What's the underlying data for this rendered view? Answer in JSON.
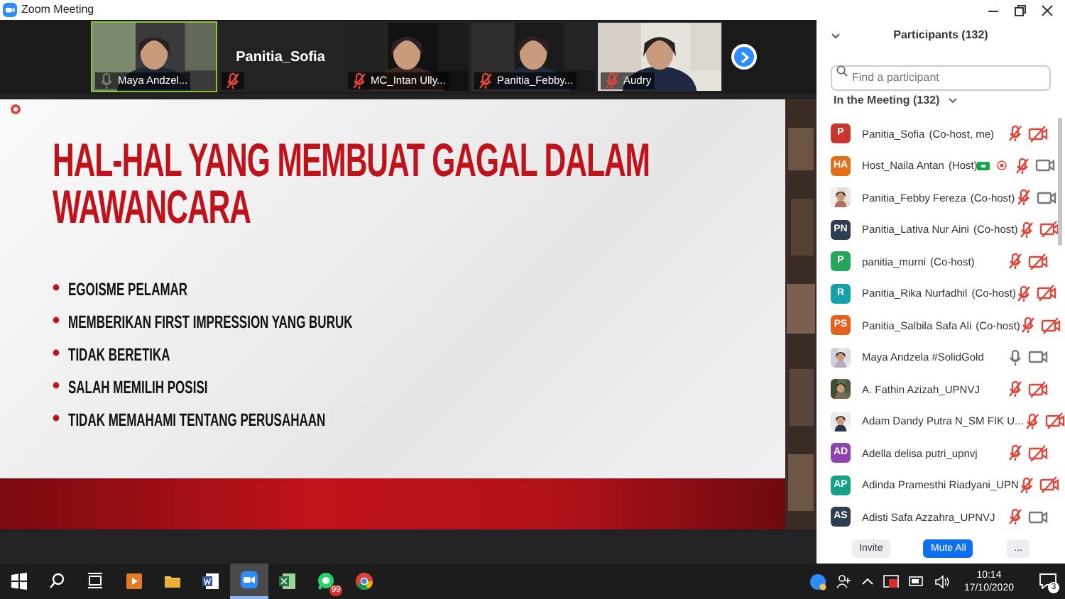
{
  "window": {
    "title": "Zoom Meeting"
  },
  "video_strip": {
    "tiles": [
      {
        "kind": "video",
        "name": "Maya Andzel...",
        "muted": false,
        "active": true
      },
      {
        "kind": "name_only",
        "name": "Panitia_Sofia",
        "muted": true,
        "active": false
      },
      {
        "kind": "video",
        "name": "MC_Intan Ully...",
        "muted": true,
        "active": false
      },
      {
        "kind": "video",
        "name": "Panitia_Febby...",
        "muted": true,
        "active": false
      },
      {
        "kind": "video",
        "name": "Audry",
        "muted": true,
        "active": false
      }
    ]
  },
  "slide": {
    "title": "HAL-HAL YANG MEMBUAT GAGAL DALAM WAWANCARA",
    "bullets": [
      "EGOISME PELAMAR",
      "MEMBERIKAN FIRST IMPRESSION YANG BURUK",
      "TIDAK BERETIKA",
      "SALAH MEMILIH POSISI",
      "TIDAK MEMAHAMI TENTANG PERUSAHAAN"
    ]
  },
  "participants_panel": {
    "title": "Participants (132)",
    "search": {
      "placeholder": "Find a participant"
    },
    "section": "In the Meeting (132)",
    "participants": [
      {
        "kind": "initials",
        "initials": "P",
        "color": "#c8372d",
        "name": "Panitia_Sofia",
        "role": "(Co-host, me)",
        "muted": true,
        "video_on": false,
        "sharing": false,
        "recording": false
      },
      {
        "kind": "initials",
        "initials": "HA",
        "color": "#e0701b",
        "name": "Host_Naila Antan",
        "role": "(Host)",
        "muted": true,
        "video_on": true,
        "sharing": true,
        "recording": true
      },
      {
        "kind": "picture",
        "name": "Panitia_Febby Fereza",
        "role": "(Co-host)",
        "muted": true,
        "video_on": true,
        "sharing": false,
        "recording": false
      },
      {
        "kind": "initials",
        "initials": "PN",
        "color": "#2d3e50",
        "name": "Panitia_Lativa Nur Aini",
        "role": "(Co-host)",
        "muted": true,
        "video_on": false,
        "sharing": false,
        "recording": false
      },
      {
        "kind": "initials",
        "initials": "P",
        "color": "#25a65a",
        "name": "panitia_murni",
        "role": "(Co-host)",
        "muted": true,
        "video_on": false,
        "sharing": false,
        "recording": false
      },
      {
        "kind": "initials",
        "initials": "R",
        "color": "#17a0a8",
        "name": "Panitia_Rika Nurfadhil",
        "role": "(Co-host)",
        "muted": true,
        "video_on": false,
        "sharing": false,
        "recording": false
      },
      {
        "kind": "initials",
        "initials": "PS",
        "color": "#e0621c",
        "name": "Panitia_Salbila Safa Ali",
        "role": "(Co-host)",
        "muted": true,
        "video_on": false,
        "sharing": false,
        "recording": false
      },
      {
        "kind": "picture",
        "name": "Maya Andzela #SolidGold",
        "muted": false,
        "video_on": true,
        "sharing": false,
        "recording": false
      },
      {
        "kind": "picture",
        "name": "A. Fathin Azizah_UPNVJ",
        "muted": true,
        "video_on": false,
        "sharing": false,
        "recording": false
      },
      {
        "kind": "picture",
        "name": "Adam Dandy Putra N_SM FIK U...",
        "muted": true,
        "video_on": false,
        "sharing": false,
        "recording": false
      },
      {
        "kind": "initials",
        "initials": "AD",
        "color": "#8e44ad",
        "name": "Adella delisa putri_upnvj",
        "muted": true,
        "video_on": false,
        "sharing": false,
        "recording": false
      },
      {
        "kind": "initials",
        "initials": "AP",
        "color": "#16a085",
        "name": "Adinda Pramesthi Riadyani_UPN",
        "muted": true,
        "video_on": false,
        "sharing": false,
        "recording": false
      },
      {
        "kind": "initials",
        "initials": "AS",
        "color": "#2d3e50",
        "name": "Adisti Safa Azzahra_UPNVJ",
        "muted": true,
        "video_on": true,
        "sharing": false,
        "recording": false
      }
    ],
    "buttons": [
      {
        "kind": "plain",
        "label": "Invite"
      },
      {
        "kind": "primary",
        "label": "Mute All"
      },
      {
        "kind": "plain",
        "label": "..."
      }
    ]
  },
  "taskbar": {
    "apps": [
      {
        "kind": "start",
        "selected": false
      },
      {
        "kind": "search",
        "selected": false
      },
      {
        "kind": "taskview",
        "selected": false
      },
      {
        "kind": "media",
        "selected": false
      },
      {
        "kind": "folder",
        "selected": false
      },
      {
        "kind": "word",
        "selected": false
      },
      {
        "kind": "zoom",
        "selected": true
      },
      {
        "kind": "excel",
        "selected": false
      },
      {
        "kind": "whatsapp",
        "selected": false,
        "badge": "99"
      },
      {
        "kind": "chrome",
        "selected": false
      }
    ],
    "time": "10:14",
    "date": "17/10/2020",
    "notifications": "3"
  }
}
